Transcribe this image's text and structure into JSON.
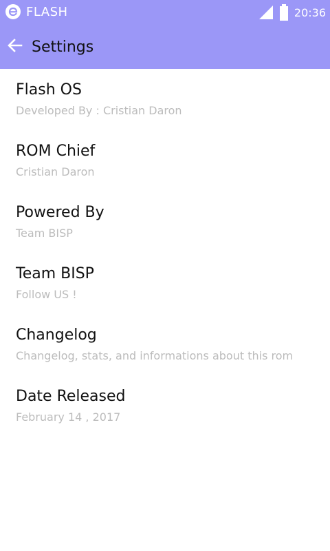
{
  "status_bar": {
    "app_name": "FLASH",
    "time": "20:36",
    "logo_icon": "e-logo-icon",
    "signal_icon": "signal-icon",
    "battery_icon": "battery-icon"
  },
  "app_bar": {
    "title": "Settings",
    "back_icon": "arrow-left-icon"
  },
  "colors": {
    "accent": "#9b97f7",
    "title_text": "#111111",
    "subtitle_text": "#bcbcbc"
  },
  "items": [
    {
      "title": "Flash OS",
      "subtitle": "Developed By : Cristian Daron"
    },
    {
      "title": "ROM Chief",
      "subtitle": "Cristian Daron"
    },
    {
      "title": "Powered By",
      "subtitle": "Team BISP"
    },
    {
      "title": "Team BISP",
      "subtitle": "Follow US !"
    },
    {
      "title": "Changelog",
      "subtitle": "Changelog, stats, and informations about this rom"
    },
    {
      "title": "Date Released",
      "subtitle": "February 14 , 2017"
    }
  ]
}
